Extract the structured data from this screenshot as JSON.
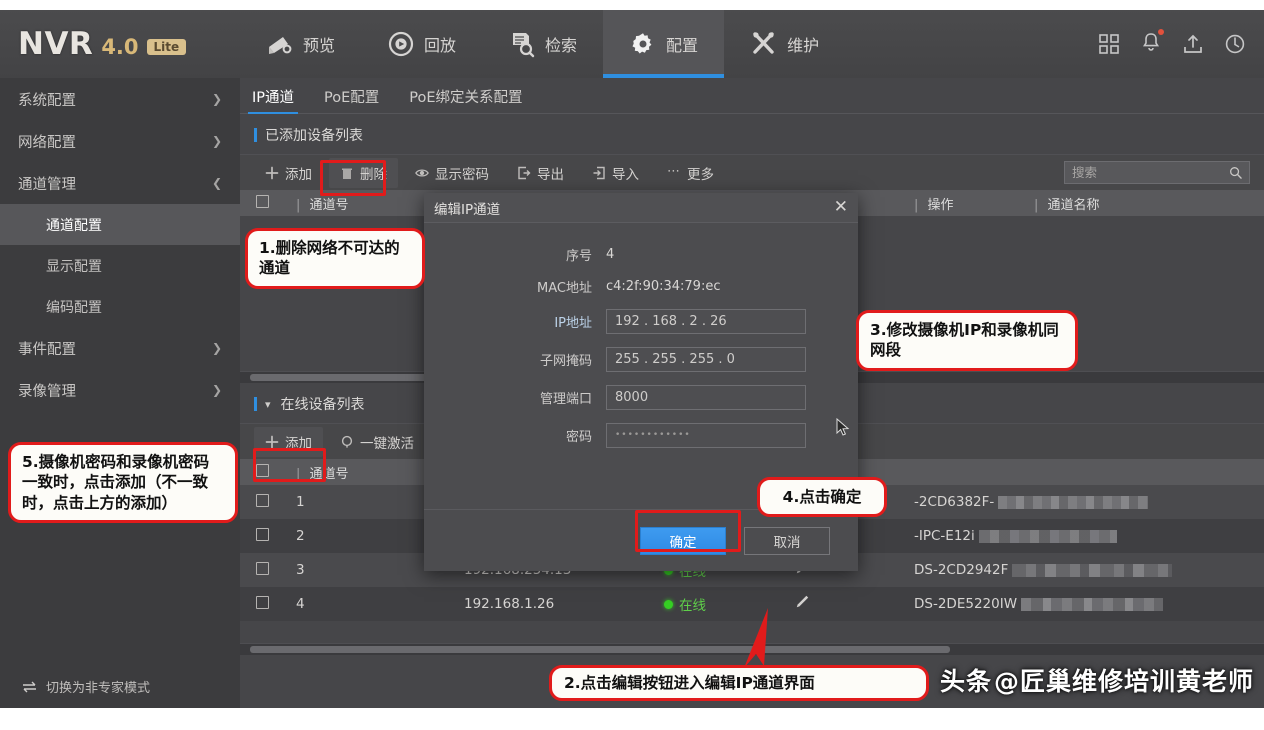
{
  "header": {
    "brand": "NVR",
    "version": "4.0",
    "edition": "Lite",
    "nav": [
      {
        "label": "预览",
        "icon": "camera-icon",
        "active": false
      },
      {
        "label": "回放",
        "icon": "playback-icon",
        "active": false
      },
      {
        "label": "检索",
        "icon": "search-doc-icon",
        "active": false
      },
      {
        "label": "配置",
        "icon": "gear-icon",
        "active": true
      },
      {
        "label": "维护",
        "icon": "tools-icon",
        "active": false
      }
    ],
    "right_icons": [
      "grid-icon",
      "bell-icon",
      "export-icon",
      "power-icon"
    ]
  },
  "sidebar": {
    "items": [
      {
        "label": "系统配置",
        "expandable": true,
        "expanded": false
      },
      {
        "label": "网络配置",
        "expandable": true,
        "expanded": false
      },
      {
        "label": "通道管理",
        "expandable": true,
        "expanded": true
      },
      {
        "label": "事件配置",
        "expandable": true,
        "expanded": false
      },
      {
        "label": "录像管理",
        "expandable": true,
        "expanded": false
      }
    ],
    "sub_items": [
      {
        "label": "通道配置",
        "active": true
      },
      {
        "label": "显示配置",
        "active": false
      },
      {
        "label": "编码配置",
        "active": false
      }
    ],
    "footer": {
      "label": "切换为非专家模式",
      "icon": "switch-icon"
    }
  },
  "content": {
    "tabs": [
      {
        "label": "IP通道",
        "active": true
      },
      {
        "label": "PoE配置",
        "active": false
      },
      {
        "label": "PoE绑定关系配置",
        "active": false
      }
    ],
    "added_section": {
      "title": "已添加设备列表",
      "toolbar": [
        {
          "label": "添加",
          "icon": "plus-icon",
          "highlighted": false
        },
        {
          "label": "删除",
          "icon": "trash-icon",
          "highlighted": true
        },
        {
          "label": "显示密码",
          "icon": "eye-icon",
          "highlighted": false
        },
        {
          "label": "导出",
          "icon": "export-arrow-icon",
          "highlighted": false
        },
        {
          "label": "导入",
          "icon": "import-arrow-icon",
          "highlighted": false
        },
        {
          "label": "更多",
          "icon": "ellipsis-icon",
          "highlighted": false
        }
      ],
      "search_placeholder": "搜索",
      "search_value": "",
      "columns": [
        "",
        "通道号",
        "",
        "",
        "操作",
        "通道名称"
      ]
    },
    "online_section": {
      "title": "在线设备列表",
      "toolbar": [
        {
          "label": "添加",
          "icon": "plus-icon",
          "highlighted": true
        },
        {
          "label": "一键激活",
          "icon": "activate-icon",
          "highlighted": false
        }
      ],
      "columns": [
        "",
        "通道号",
        "",
        "",
        "",
        ""
      ],
      "rows": [
        {
          "ch": "1",
          "ip": "",
          "status": "",
          "model": "-2CD6382F-",
          "masked": true
        },
        {
          "ch": "2",
          "ip": "",
          "status": "",
          "model": "-IPC-E12i",
          "masked": true
        },
        {
          "ch": "3",
          "ip": "192.168.254.13",
          "status": "在线",
          "model": "DS-2CD2942F",
          "masked": true
        },
        {
          "ch": "4",
          "ip": "192.168.1.26",
          "status": "在线",
          "model": "DS-2DE5220IW",
          "masked": true
        }
      ]
    }
  },
  "dialog": {
    "title": "编辑IP通道",
    "close_icon": "close-icon",
    "fields": [
      {
        "label": "序号",
        "value": "4",
        "type": "text"
      },
      {
        "label": "MAC地址",
        "value": "c4:2f:90:34:79:ec",
        "type": "text"
      },
      {
        "label": "IP地址",
        "value": "192 . 168 . 2  . 26",
        "type": "input"
      },
      {
        "label": "子网掩码",
        "value": "255 . 255 . 255 . 0",
        "type": "input"
      },
      {
        "label": "管理端口",
        "value": "8000",
        "type": "input"
      },
      {
        "label": "密码",
        "value": "••••••••••••",
        "type": "password"
      }
    ],
    "ok_label": "确定",
    "cancel_label": "取消"
  },
  "annotations": [
    {
      "id": 1,
      "text": "1.删除网络不可达的通道"
    },
    {
      "id": 2,
      "text": "2.点击编辑按钮进入编辑IP通道界面"
    },
    {
      "id": 3,
      "text": "3.修改摄像机IP和录像机同网段"
    },
    {
      "id": 4,
      "text": "4.点击确定"
    },
    {
      "id": 5,
      "text": "5.摄像机密码和录像机密码一致时，点击添加（不一致时，点击上方的添加）"
    }
  ],
  "watermark": {
    "prefix": "头条",
    "handle": "@匠巢维修培训黄老师"
  },
  "colors": {
    "accent": "#2f8fe0",
    "highlight": "#e11b1b",
    "online": "#35cf23",
    "gold": "#d8b878"
  }
}
